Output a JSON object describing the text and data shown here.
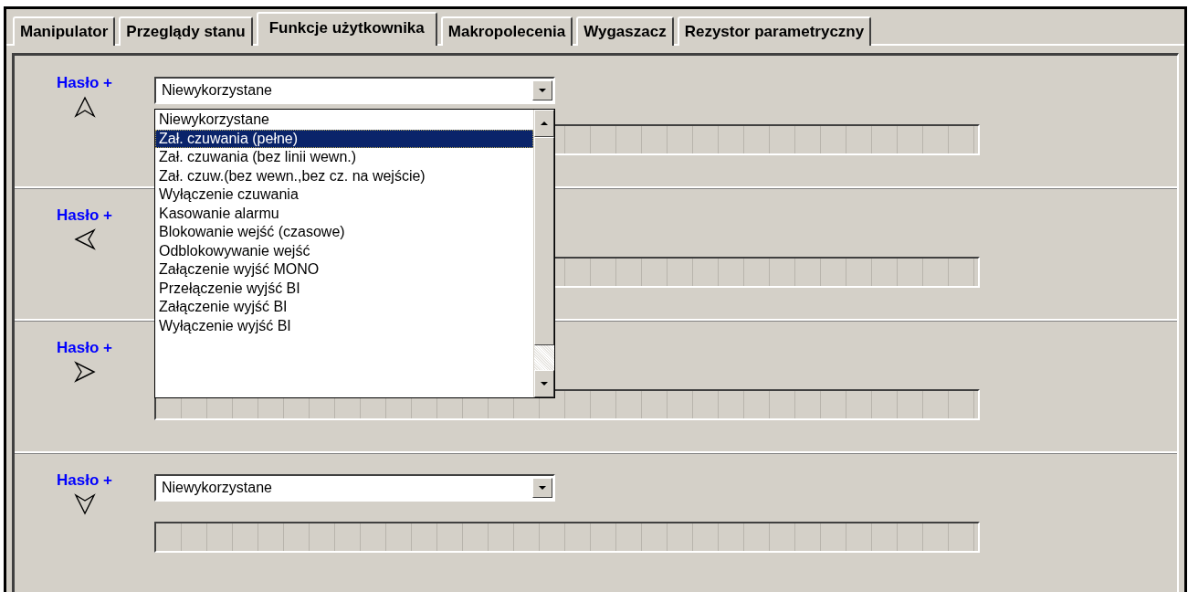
{
  "tabs": [
    {
      "label": "Manipulator",
      "selected": false
    },
    {
      "label": "Przeglądy stanu",
      "selected": false
    },
    {
      "label": "Funkcje użytkownika",
      "selected": true
    },
    {
      "label": "Makropolecenia",
      "selected": false
    },
    {
      "label": "Wygaszacz",
      "selected": false
    },
    {
      "label": "Rezystor parametryczny",
      "selected": false
    }
  ],
  "sections": [
    {
      "label": "Hasło +",
      "kind": "up",
      "combo": {
        "value": "Niewykorzystane",
        "options": [
          {
            "label": "Niewykorzystane",
            "highlighted": false
          },
          {
            "label": "Zał. czuwania (pełne)",
            "highlighted": true
          },
          {
            "label": "Zał. czuwania (bez linii wewn.)",
            "highlighted": false
          },
          {
            "label": "Zał. czuw.(bez wewn.,bez cz. na wejście)",
            "highlighted": false
          },
          {
            "label": "Wyłączenie czuwania",
            "highlighted": false
          },
          {
            "label": "Kasowanie alarmu",
            "highlighted": false
          },
          {
            "label": "Blokowanie wejść (czasowe)",
            "highlighted": false
          },
          {
            "label": "Odblokowywanie wejść",
            "highlighted": false
          },
          {
            "label": "Załączenie wyjść MONO",
            "highlighted": false
          },
          {
            "label": "Przełączenie wyjść BI",
            "highlighted": false
          },
          {
            "label": "Załączenie wyjść BI",
            "highlighted": false
          },
          {
            "label": "Wyłączenie wyjść BI",
            "highlighted": false
          }
        ]
      }
    },
    {
      "label": "Hasło +",
      "kind": "left"
    },
    {
      "label": "Hasło +",
      "kind": "right"
    },
    {
      "label": "Hasło +",
      "kind": "down",
      "combo": {
        "value": "Niewykorzystane"
      }
    }
  ]
}
